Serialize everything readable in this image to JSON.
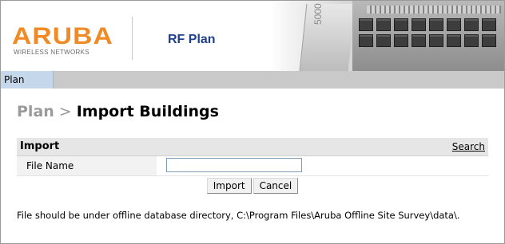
{
  "brand": {
    "logo_text": "ARUBA",
    "logo_tagline": "WIRELESS NETWORKS",
    "app_title": "RF Plan",
    "logo_color": "#f08a24",
    "title_color": "#1f3f8f",
    "hardware_model": "5000"
  },
  "nav": {
    "tabs": [
      {
        "label": "Plan",
        "active": true
      }
    ]
  },
  "breadcrumb": {
    "parent": "Plan",
    "separator": ">",
    "current": "Import Buildings"
  },
  "import_panel": {
    "title": "Import",
    "search_link": "Search",
    "file_name_label": "File Name",
    "file_name_value": "",
    "import_button": "Import",
    "cancel_button": "Cancel",
    "note": "File should be under offline database directory, C:\\Program Files\\Aruba Offline Site Survey\\data\\."
  }
}
